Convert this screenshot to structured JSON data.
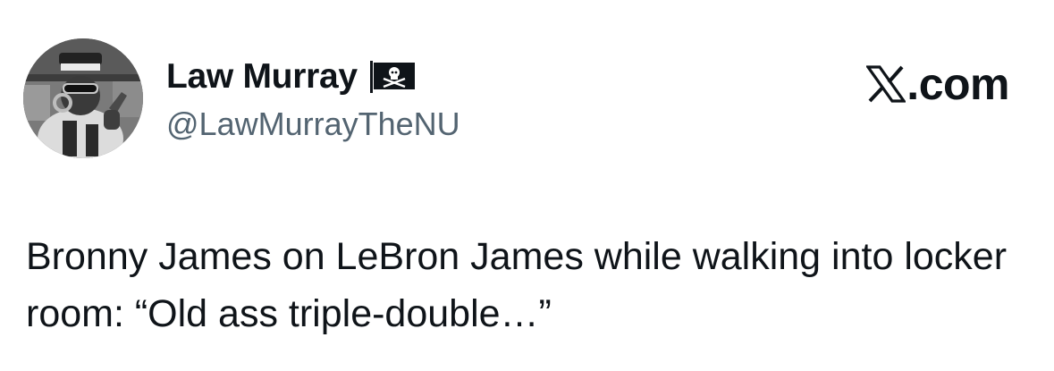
{
  "tweet": {
    "author": {
      "display_name": "Law Murray",
      "name_emoji_icon": "pirate-flag-icon",
      "handle": "@LawMurrayTheNU"
    },
    "brand": {
      "logo_icon": "x-logo-icon",
      "suffix": ".com"
    },
    "text": "Bronny James on LeBron James while walking into locker room: “Old ass triple-double…”"
  }
}
